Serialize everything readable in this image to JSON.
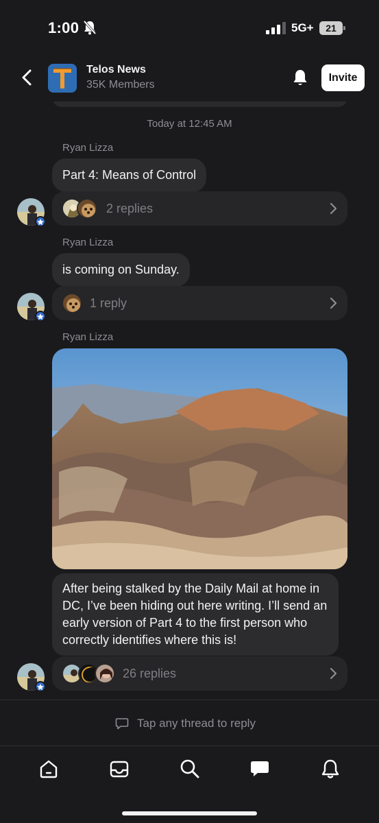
{
  "status_bar": {
    "time": "1:00",
    "network": "5G+",
    "battery": "21"
  },
  "header": {
    "group_logo_letter": "T",
    "group_name": "Telos News",
    "members": "35K Members",
    "invite_label": "Invite"
  },
  "feed": {
    "timestamp": "Today at 12:45 AM",
    "messages": [
      {
        "sender": "Ryan Lizza",
        "text": "Part 4: Means of Control",
        "replies": "2 replies"
      },
      {
        "sender": "Ryan Lizza",
        "text": "is coming on Sunday.",
        "replies": "1 reply"
      },
      {
        "sender": "Ryan Lizza",
        "image_alt": "desert badlands landscape photo",
        "text": "After being stalked by the Daily Mail at home in DC, I’ve been hiding out here writing. I’ll send an early version of Part 4 to the first person who correctly identifies where this is!",
        "replies": "26 replies"
      }
    ]
  },
  "composer": {
    "placeholder": "Tap any thread to reply"
  },
  "tabs": [
    "home-icon",
    "inbox-icon",
    "search-icon",
    "chat-icon",
    "notifications-icon"
  ],
  "colors": {
    "background": "#1a1a1c",
    "bubble": "#2c2c2e",
    "accent": "#2f6bd0",
    "logo_bg": "#2e6db4",
    "logo_letter": "#f29a2e"
  }
}
